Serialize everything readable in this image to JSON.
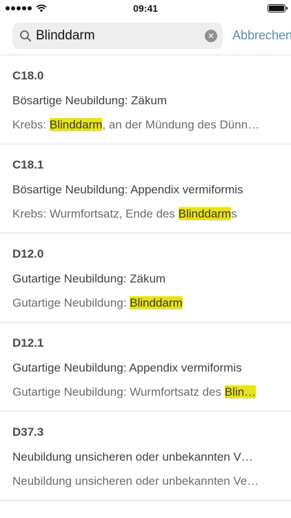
{
  "status": {
    "time": "09:41"
  },
  "search": {
    "value": "Blinddarm",
    "cancel_label": "Abbrechen"
  },
  "results": [
    {
      "code": "C18.0",
      "title": "Bösartige Neubildung: Zäkum",
      "sub_before": "Krebs: ",
      "sub_highlight": "Blinddarm",
      "sub_after": ", an der Mündung des Dünn…"
    },
    {
      "code": "C18.1",
      "title": "Bösartige Neubildung: Appendix vermiformis",
      "sub_before": "Krebs: Wurmfortsatz, Ende des ",
      "sub_highlight": "Blinddarm",
      "sub_after": "s"
    },
    {
      "code": "D12.0",
      "title": "Gutartige Neubildung: Zäkum",
      "sub_before": "Gutartige Neubildung: ",
      "sub_highlight": "Blinddarm",
      "sub_after": ""
    },
    {
      "code": "D12.1",
      "title": "Gutartige Neubildung: Appendix vermiformis",
      "sub_before": "Gutartige Neubildung: Wurmfortsatz des ",
      "sub_highlight": "Blin…",
      "sub_after": ""
    },
    {
      "code": "D37.3",
      "title": "Neubildung unsicheren oder unbekannten V…",
      "sub_before": "Neubildung unsicheren oder unbekannten Ve…",
      "sub_highlight": "",
      "sub_after": ""
    }
  ],
  "colors": {
    "accent": "#5a8fa6",
    "highlight": "#e8e314"
  }
}
